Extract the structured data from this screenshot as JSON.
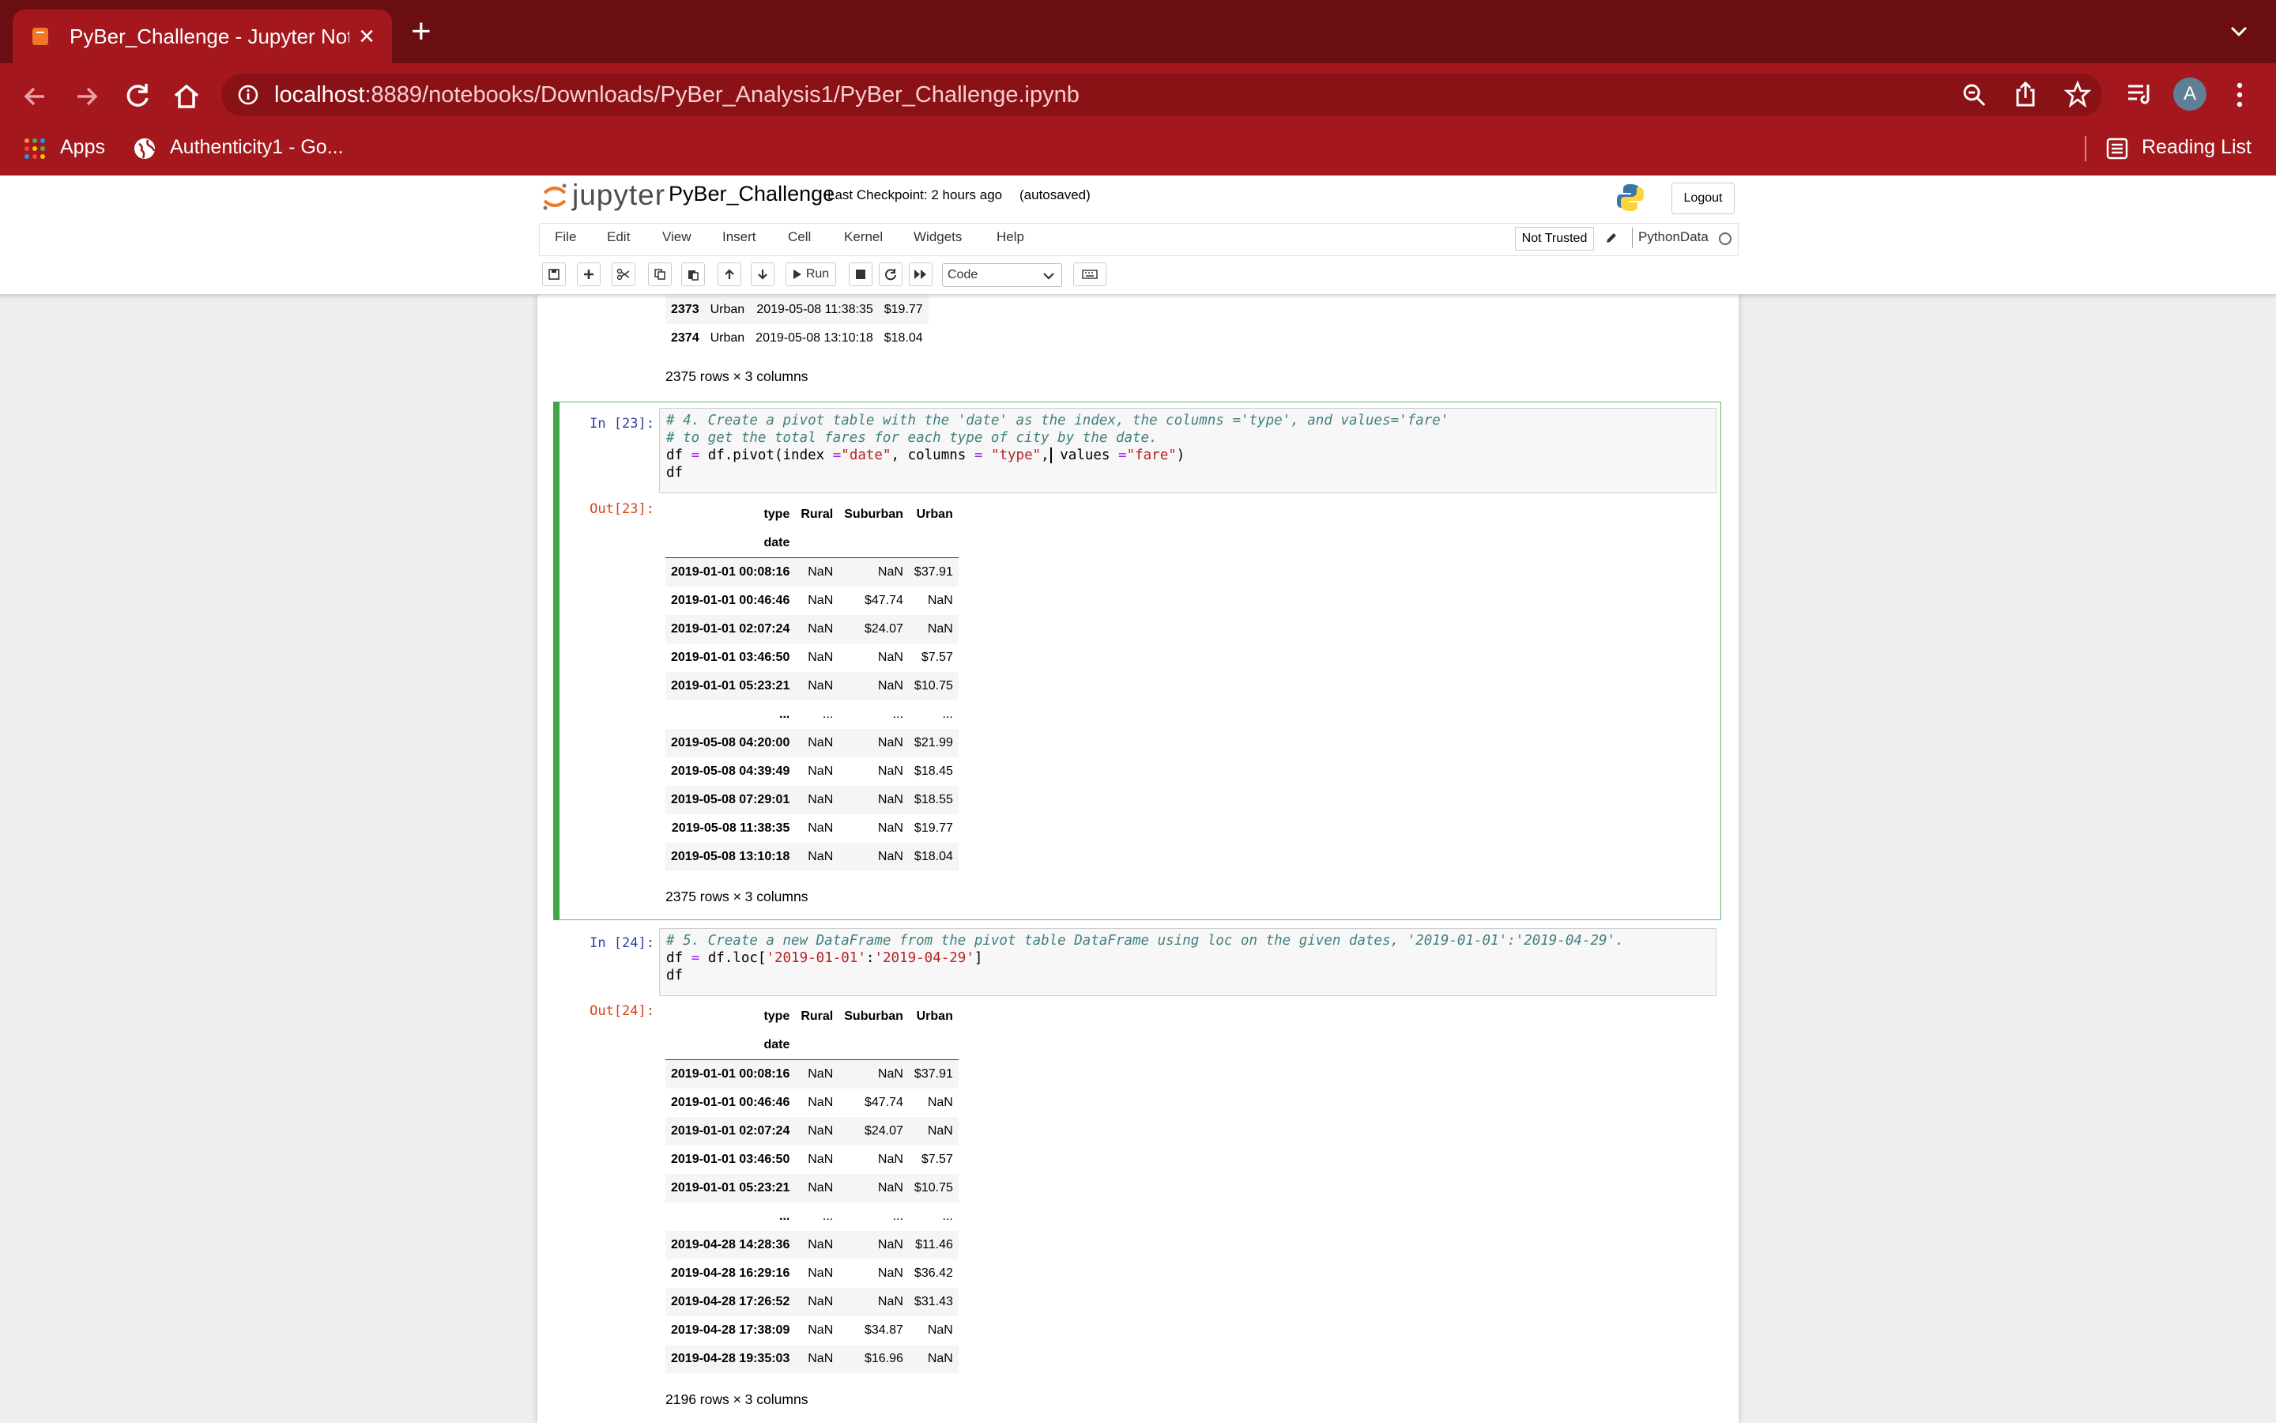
{
  "browser": {
    "tab_title": "PyBer_Challenge - Jupyter Not",
    "url_host": "localhost",
    "url_rest": ":8889/notebooks/Downloads/PyBer_Analysis1/PyBer_Challenge.ipynb",
    "profile_initial": "A",
    "bookmarks": {
      "apps": "Apps",
      "authenticity": "Authenticity1 - Go...",
      "reading_list": "Reading List"
    },
    "colors": {
      "tabstrip": "#6b0e12",
      "toolbar": "#a3171d"
    }
  },
  "jupyter": {
    "logo_text": "jupyter",
    "notebook_name": "PyBer_Challenge",
    "checkpoint": "Last Checkpoint: 2 hours ago",
    "autosave": "(autosaved)",
    "logout": "Logout",
    "menu": [
      "File",
      "Edit",
      "View",
      "Insert",
      "Cell",
      "Kernel",
      "Widgets",
      "Help"
    ],
    "not_trusted": "Not Trusted",
    "kernel": "PythonData",
    "run_label": "Run",
    "cell_type": "Code"
  },
  "top_fragment": {
    "rows": [
      [
        "2373",
        "Urban",
        "2019-05-08 11:38:35",
        "$19.77"
      ],
      [
        "2374",
        "Urban",
        "2019-05-08 13:10:18",
        "$18.04"
      ]
    ],
    "summary": "2375 rows × 3 columns"
  },
  "cells": [
    {
      "in_prompt": "In [23]:",
      "out_prompt": "Out[23]:",
      "columns_name": "type",
      "index_name": "date",
      "columns": [
        "Rural",
        "Suburban",
        "Urban"
      ],
      "rows": [
        [
          "2019-01-01 00:08:16",
          "NaN",
          "NaN",
          "$37.91"
        ],
        [
          "2019-01-01 00:46:46",
          "NaN",
          "$47.74",
          "NaN"
        ],
        [
          "2019-01-01 02:07:24",
          "NaN",
          "$24.07",
          "NaN"
        ],
        [
          "2019-01-01 03:46:50",
          "NaN",
          "NaN",
          "$7.57"
        ],
        [
          "2019-01-01 05:23:21",
          "NaN",
          "NaN",
          "$10.75"
        ],
        [
          "...",
          "...",
          "...",
          "..."
        ],
        [
          "2019-05-08 04:20:00",
          "NaN",
          "NaN",
          "$21.99"
        ],
        [
          "2019-05-08 04:39:49",
          "NaN",
          "NaN",
          "$18.45"
        ],
        [
          "2019-05-08 07:29:01",
          "NaN",
          "NaN",
          "$18.55"
        ],
        [
          "2019-05-08 11:38:35",
          "NaN",
          "NaN",
          "$19.77"
        ],
        [
          "2019-05-08 13:10:18",
          "NaN",
          "NaN",
          "$18.04"
        ]
      ],
      "summary": "2375 rows × 3 columns"
    },
    {
      "in_prompt": "In [24]:",
      "out_prompt": "Out[24]:",
      "columns_name": "type",
      "index_name": "date",
      "columns": [
        "Rural",
        "Suburban",
        "Urban"
      ],
      "rows": [
        [
          "2019-01-01 00:08:16",
          "NaN",
          "NaN",
          "$37.91"
        ],
        [
          "2019-01-01 00:46:46",
          "NaN",
          "$47.74",
          "NaN"
        ],
        [
          "2019-01-01 02:07:24",
          "NaN",
          "$24.07",
          "NaN"
        ],
        [
          "2019-01-01 03:46:50",
          "NaN",
          "NaN",
          "$7.57"
        ],
        [
          "2019-01-01 05:23:21",
          "NaN",
          "NaN",
          "$10.75"
        ],
        [
          "...",
          "...",
          "...",
          "..."
        ],
        [
          "2019-04-28 14:28:36",
          "NaN",
          "NaN",
          "$11.46"
        ],
        [
          "2019-04-28 16:29:16",
          "NaN",
          "NaN",
          "$36.42"
        ],
        [
          "2019-04-28 17:26:52",
          "NaN",
          "NaN",
          "$31.43"
        ],
        [
          "2019-04-28 17:38:09",
          "NaN",
          "$34.87",
          "NaN"
        ],
        [
          "2019-04-28 19:35:03",
          "NaN",
          "$16.96",
          "NaN"
        ]
      ],
      "summary": "2196 rows × 3 columns"
    }
  ]
}
